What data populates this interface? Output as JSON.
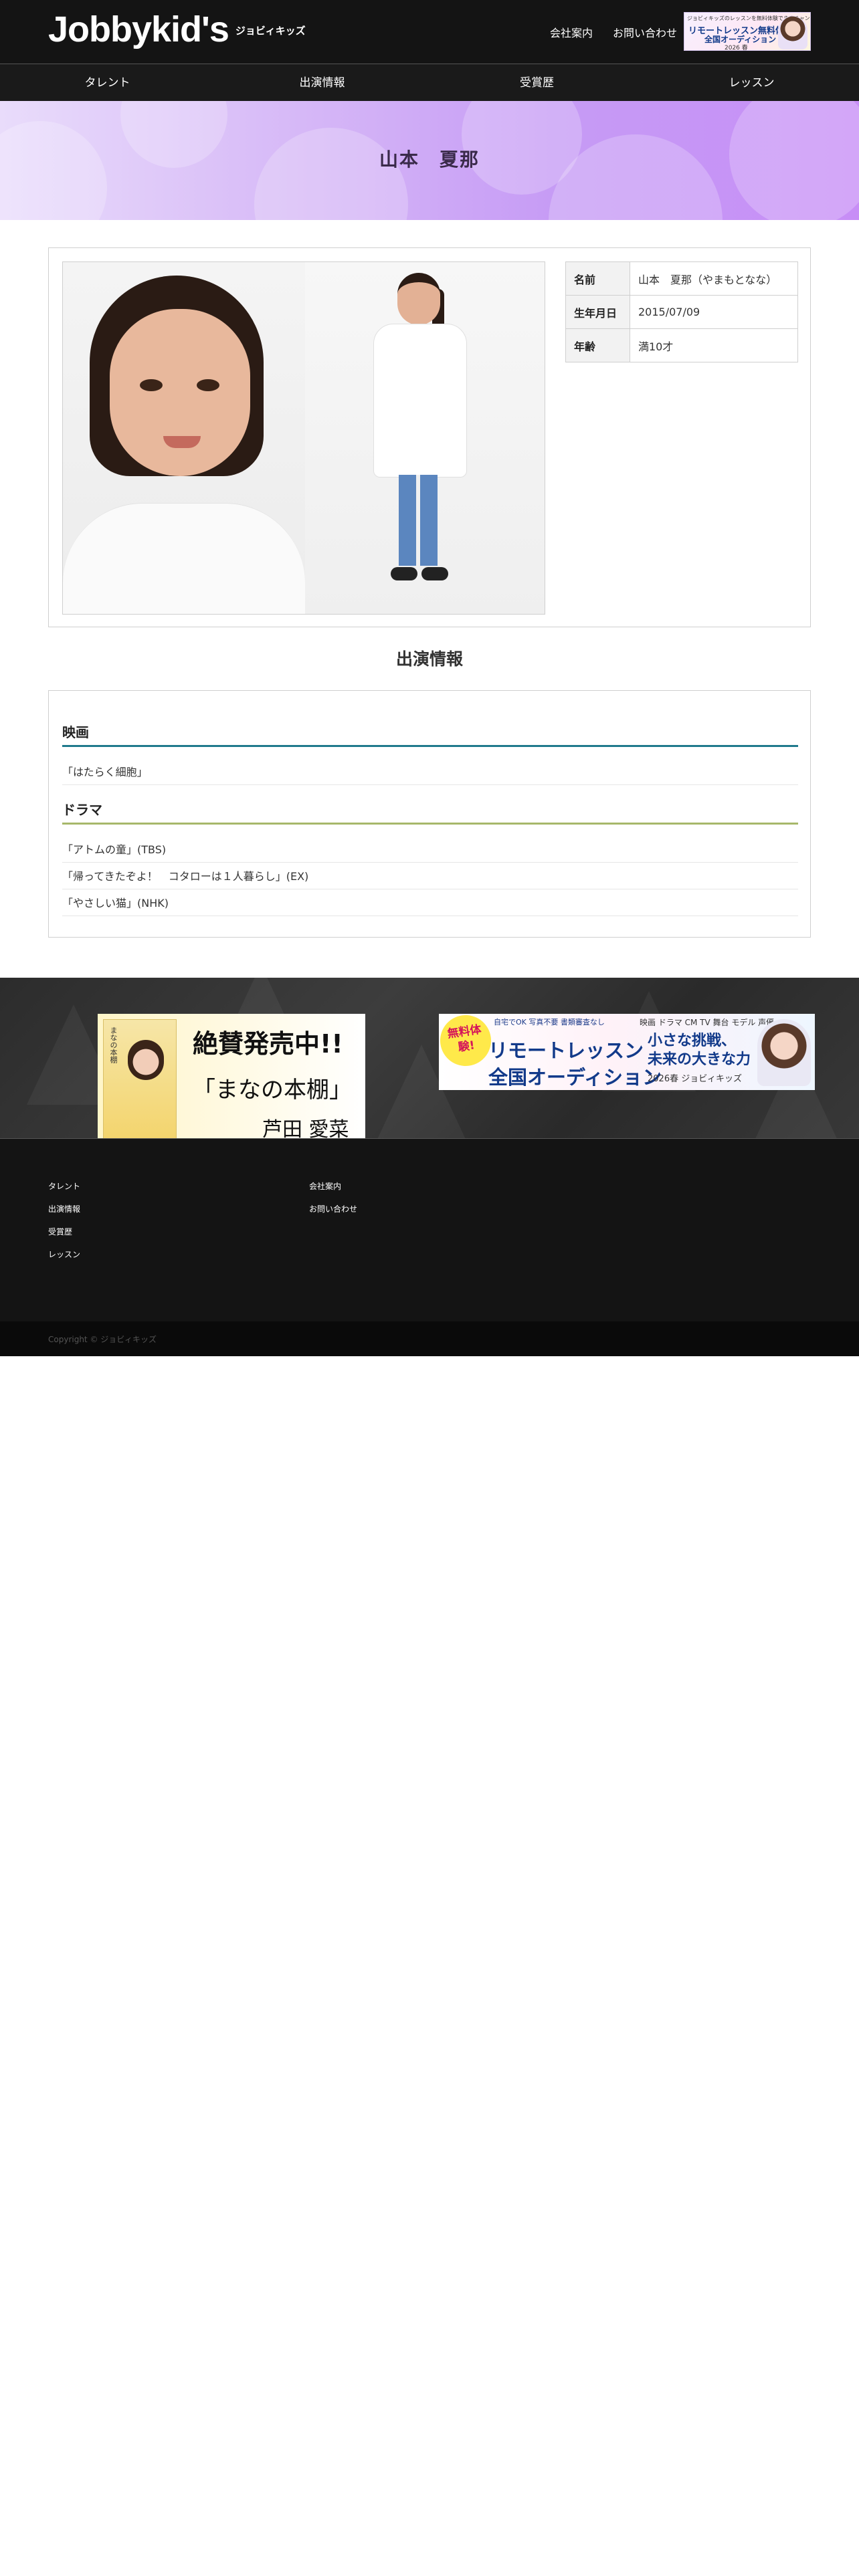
{
  "header": {
    "logo_main": "Jobbykid's",
    "logo_sub": "ジョビィキッズ",
    "util_links": [
      "会社案内",
      "お問い合わせ"
    ],
    "banner": {
      "line1": "ジョビィキッズのレッスンを無料体験できるチャンス！",
      "line2": "リモートレッスン無料体験",
      "line3": "全国オーディション",
      "line4": "2026 春"
    }
  },
  "nav": [
    "タレント",
    "出演情報",
    "受賞歴",
    "レッスン"
  ],
  "hero": {
    "title": "山本　夏那"
  },
  "profile": {
    "rows": [
      {
        "label": "名前",
        "value": "山本　夏那（やまもとなな）"
      },
      {
        "label": "生年月日",
        "value": "2015/07/09"
      },
      {
        "label": "年齢",
        "value": "満10才"
      }
    ]
  },
  "appearances": {
    "title": "出演情報",
    "categories": [
      {
        "name": "映画",
        "works": [
          "「はたらく細胞」"
        ]
      },
      {
        "name": "ドラマ",
        "works": [
          "「アトムの童」(TBS)",
          "「帰ってきたぞよ！　コタローは１人暮らし」(EX)",
          "「やさしい猫」(NHK)"
        ]
      }
    ]
  },
  "banners": {
    "book": {
      "book_title": "まなの本棚",
      "main": "絶賛発売中!!",
      "title": "「まなの本棚」",
      "author": "芦田 愛菜"
    },
    "audition": {
      "badge": "無料体験!",
      "tags": "自宅でOK  写真不要  書類審査なし",
      "main1": "リモートレッスン",
      "main2": "全国オーディション",
      "right1": "映画 ドラマ CM TV 舞台 モデル 声優",
      "right2": "小さな挑戦、",
      "right3": "未来の大きな力",
      "right4": "2026春 ジョビィキッズ"
    }
  },
  "footer": {
    "col1": [
      "タレント",
      "出演情報",
      "受賞歴",
      "レッスン"
    ],
    "col2": [
      "会社案内",
      "お問い合わせ"
    ],
    "copyright": "Copyright © ジョビィキッズ"
  }
}
